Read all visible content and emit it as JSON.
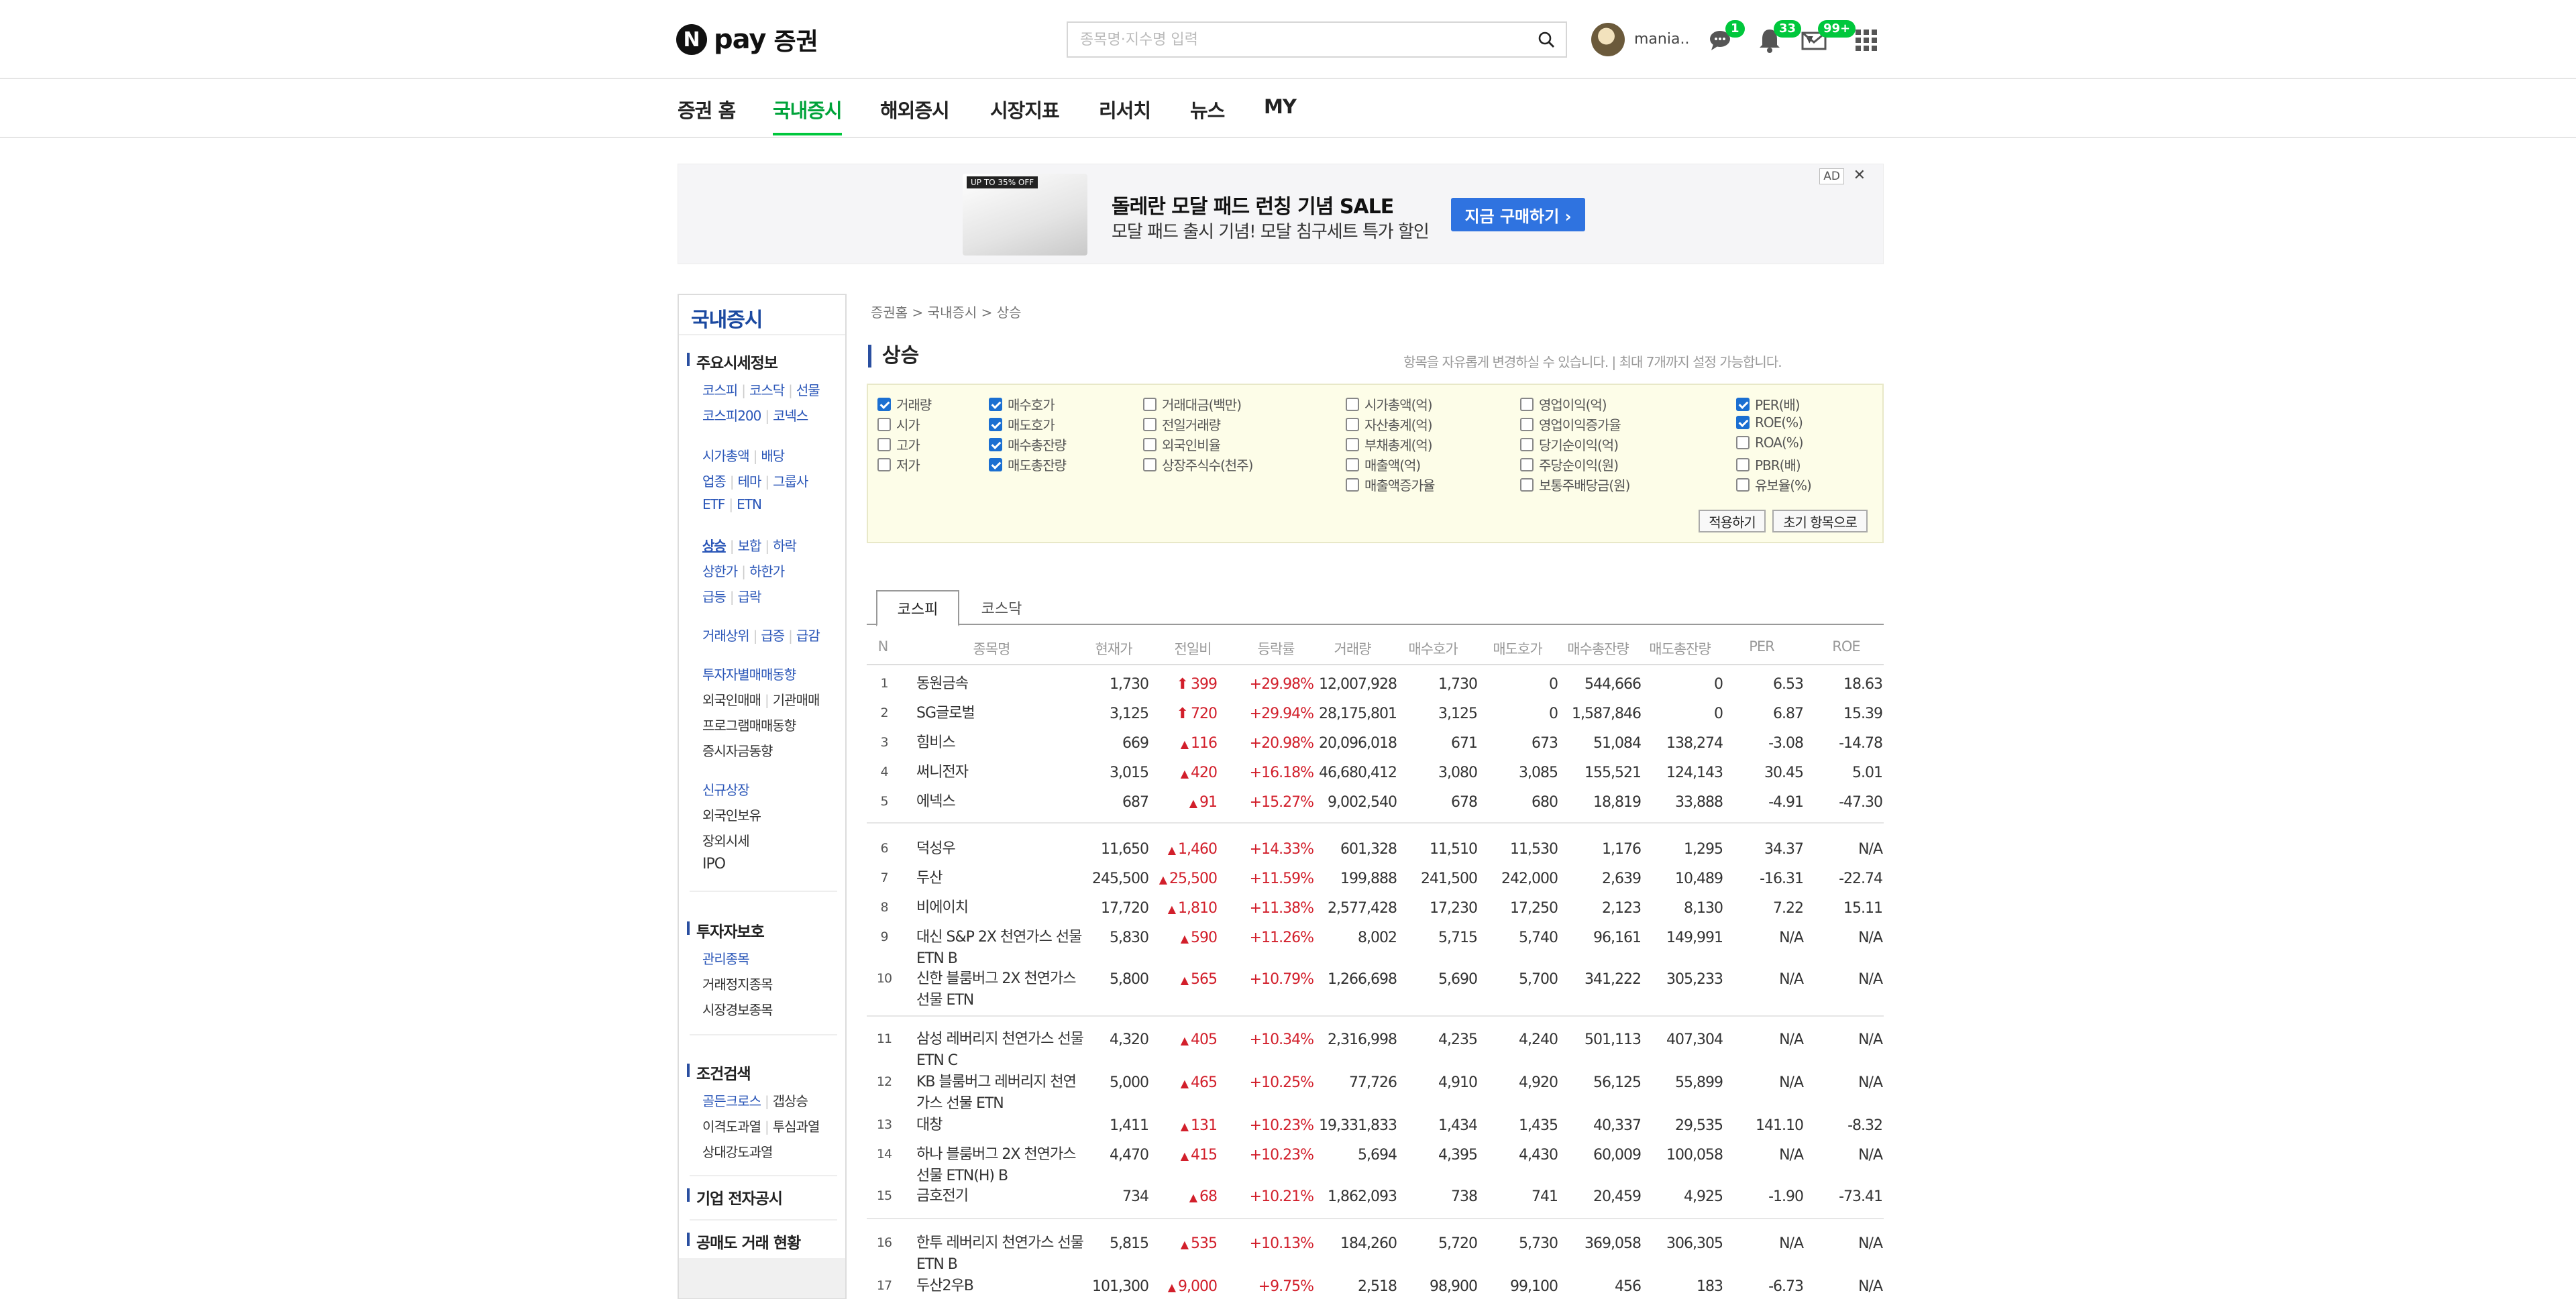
{
  "header": {
    "logo_n": "N",
    "logo_pay": "pay",
    "logo_service": "증권",
    "search_placeholder": "종목명·지수명 입력",
    "user_name": "mania..",
    "badges": {
      "talk": "1",
      "bell": "33",
      "mail": "99+"
    }
  },
  "nav": {
    "items": [
      {
        "label": "증권 홈",
        "active": false
      },
      {
        "label": "국내증시",
        "active": true
      },
      {
        "label": "해외증시",
        "active": false
      },
      {
        "label": "시장지표",
        "active": false
      },
      {
        "label": "리서치",
        "active": false
      },
      {
        "label": "뉴스",
        "active": false
      },
      {
        "label": "MY",
        "active": false
      }
    ]
  },
  "ad": {
    "image_tag": "UP TO 35% OFF",
    "title": "돌레란 모달 패드 런칭 기념 SALE",
    "subtitle": "모달 패드 출시 기념! 모달 침구세트 특가 할인",
    "button": "지금 구매하기 ›",
    "ad_label": "AD",
    "close": "✕"
  },
  "sidebar": {
    "title": "국내증시",
    "groups": [
      {
        "title": "주요시세정보"
      },
      {
        "title": "투자자보호"
      },
      {
        "title": "조건검색"
      },
      {
        "title": "기업 전자공시"
      },
      {
        "title": "공매도 거래 현황"
      }
    ],
    "links": {
      "kospi": "코스피",
      "kosdaq": "코스닥",
      "futures": "선물",
      "kospi200": "코스피200",
      "konex": "코넥스",
      "market_cap": "시가총액",
      "dividend": "배당",
      "sector": "업종",
      "theme": "테마",
      "group": "그룹사",
      "etf": "ETF",
      "etn": "ETN",
      "rise": "상승",
      "flat": "보합",
      "fall": "하락",
      "upper": "상한가",
      "lower": "하한가",
      "surge": "급등",
      "plunge": "급락",
      "volume_top": "거래상위",
      "vol_surge": "급증",
      "vol_drop": "급감",
      "investor": "투자자별매매동향",
      "foreign": "외국인매매",
      "institution": "기관매매",
      "program": "프로그램매매동향",
      "fund": "증시자금동향",
      "new_listing": "신규상장",
      "foreign_hold": "외국인보유",
      "otc": "장외시세",
      "ipo": "IPO",
      "managed": "관리종목",
      "halted": "거래정지종목",
      "warning": "시장경보종목",
      "golden": "골든크로스",
      "gap_up": "갭상승",
      "disparity": "이격도과열",
      "psych": "투심과열",
      "rsi": "상대강도과열"
    }
  },
  "content": {
    "breadcrumb": "증권홈 > 국내증시 > 상승",
    "title": "상승",
    "note": "항목을 자유롭게 변경하실 수 있습니다.  |  최대 7개까지 설정 가능합니다.",
    "options": [
      [
        {
          "label": "거래량",
          "on": true
        },
        {
          "label": "시가",
          "on": false
        },
        {
          "label": "고가",
          "on": false
        },
        {
          "label": "저가",
          "on": false
        }
      ],
      [
        {
          "label": "매수호가",
          "on": true
        },
        {
          "label": "매도호가",
          "on": true
        },
        {
          "label": "매수총잔량",
          "on": true
        },
        {
          "label": "매도총잔량",
          "on": true
        }
      ],
      [
        {
          "label": "거래대금(백만)",
          "on": false
        },
        {
          "label": "전일거래량",
          "on": false
        },
        {
          "label": "외국인비율",
          "on": false
        },
        {
          "label": "상장주식수(천주)",
          "on": false
        }
      ],
      [
        {
          "label": "시가총액(억)",
          "on": false
        },
        {
          "label": "자산총계(억)",
          "on": false
        },
        {
          "label": "부채총계(억)",
          "on": false
        },
        {
          "label": "매출액(억)",
          "on": false
        },
        {
          "label": "매출액증가율",
          "on": false
        }
      ],
      [
        {
          "label": "영업이익(억)",
          "on": false
        },
        {
          "label": "영업이익증가율",
          "on": false
        },
        {
          "label": "당기순이익(억)",
          "on": false
        },
        {
          "label": "주당순이익(원)",
          "on": false
        },
        {
          "label": "보통주배당금(원)",
          "on": false
        }
      ],
      [
        {
          "label": "PER(배)",
          "on": true
        },
        {
          "label": "ROE(%)",
          "on": true
        },
        {
          "label": "ROA(%)",
          "on": false
        },
        {
          "label": "PBR(배)",
          "on": false
        },
        {
          "label": "유보율(%)",
          "on": false
        }
      ]
    ],
    "apply": "적용하기",
    "reset": "초기 항목으로",
    "tabs": [
      "코스피",
      "코스닥"
    ],
    "columns": [
      "N",
      "종목명",
      "현재가",
      "전일비",
      "등락률",
      "거래량",
      "매수호가",
      "매도호가",
      "매수총잔량",
      "매도총잔량",
      "PER",
      "ROE"
    ],
    "rows": [
      {
        "n": "1",
        "name": "동원금속",
        "price": "1,730",
        "arrow": "⬆",
        "diff": "399",
        "rate": "+29.98%",
        "vol": "12,007,928",
        "bid": "1,730",
        "ask": "0",
        "bidq": "544,666",
        "askq": "0",
        "per": "6.53",
        "roe": "18.63"
      },
      {
        "n": "2",
        "name": "SG글로벌",
        "price": "3,125",
        "arrow": "⬆",
        "diff": "720",
        "rate": "+29.94%",
        "vol": "28,175,801",
        "bid": "3,125",
        "ask": "0",
        "bidq": "1,587,846",
        "askq": "0",
        "per": "6.87",
        "roe": "15.39"
      },
      {
        "n": "3",
        "name": "힘비스",
        "price": "669",
        "arrow": "▲",
        "diff": "116",
        "rate": "+20.98%",
        "vol": "20,096,018",
        "bid": "671",
        "ask": "673",
        "bidq": "51,084",
        "askq": "138,274",
        "per": "-3.08",
        "roe": "-14.78"
      },
      {
        "n": "4",
        "name": "써니전자",
        "price": "3,015",
        "arrow": "▲",
        "diff": "420",
        "rate": "+16.18%",
        "vol": "46,680,412",
        "bid": "3,080",
        "ask": "3,085",
        "bidq": "155,521",
        "askq": "124,143",
        "per": "30.45",
        "roe": "5.01"
      },
      {
        "n": "5",
        "name": "에넥스",
        "price": "687",
        "arrow": "▲",
        "diff": "91",
        "rate": "+15.27%",
        "vol": "9,002,540",
        "bid": "678",
        "ask": "680",
        "bidq": "18,819",
        "askq": "33,888",
        "per": "-4.91",
        "roe": "-47.30"
      },
      {
        "n": "6",
        "name": "덕성우",
        "price": "11,650",
        "arrow": "▲",
        "diff": "1,460",
        "rate": "+14.33%",
        "vol": "601,328",
        "bid": "11,510",
        "ask": "11,530",
        "bidq": "1,176",
        "askq": "1,295",
        "per": "34.37",
        "roe": "N/A"
      },
      {
        "n": "7",
        "name": "두산",
        "price": "245,500",
        "arrow": "▲",
        "diff": "25,500",
        "rate": "+11.59%",
        "vol": "199,888",
        "bid": "241,500",
        "ask": "242,000",
        "bidq": "2,639",
        "askq": "10,489",
        "per": "-16.31",
        "roe": "-22.74"
      },
      {
        "n": "8",
        "name": "비에이치",
        "price": "17,720",
        "arrow": "▲",
        "diff": "1,810",
        "rate": "+11.38%",
        "vol": "2,577,428",
        "bid": "17,230",
        "ask": "17,250",
        "bidq": "2,123",
        "askq": "8,130",
        "per": "7.22",
        "roe": "15.11"
      },
      {
        "n": "9",
        "name": "대신 S&P 2X 천연가스 선물 ETN B",
        "price": "5,830",
        "arrow": "▲",
        "diff": "590",
        "rate": "+11.26%",
        "vol": "8,002",
        "bid": "5,715",
        "ask": "5,740",
        "bidq": "96,161",
        "askq": "149,991",
        "per": "N/A",
        "roe": "N/A"
      },
      {
        "n": "10",
        "name": "신한 블룸버그 2X 천연가스 선물 ETN",
        "price": "5,800",
        "arrow": "▲",
        "diff": "565",
        "rate": "+10.79%",
        "vol": "1,266,698",
        "bid": "5,690",
        "ask": "5,700",
        "bidq": "341,222",
        "askq": "305,233",
        "per": "N/A",
        "roe": "N/A"
      },
      {
        "n": "11",
        "name": "삼성 레버리지 천연가스 선물 ETN C",
        "price": "4,320",
        "arrow": "▲",
        "diff": "405",
        "rate": "+10.34%",
        "vol": "2,316,998",
        "bid": "4,235",
        "ask": "4,240",
        "bidq": "501,113",
        "askq": "407,304",
        "per": "N/A",
        "roe": "N/A"
      },
      {
        "n": "12",
        "name": "KB 블룸버그 레버리지 천연가스 선물 ETN",
        "price": "5,000",
        "arrow": "▲",
        "diff": "465",
        "rate": "+10.25%",
        "vol": "77,726",
        "bid": "4,910",
        "ask": "4,920",
        "bidq": "56,125",
        "askq": "55,899",
        "per": "N/A",
        "roe": "N/A"
      },
      {
        "n": "13",
        "name": "대창",
        "price": "1,411",
        "arrow": "▲",
        "diff": "131",
        "rate": "+10.23%",
        "vol": "19,331,833",
        "bid": "1,434",
        "ask": "1,435",
        "bidq": "40,337",
        "askq": "29,535",
        "per": "141.10",
        "roe": "-8.32"
      },
      {
        "n": "14",
        "name": "하나 블룸버그 2X 천연가스 선물 ETN(H) B",
        "price": "4,470",
        "arrow": "▲",
        "diff": "415",
        "rate": "+10.23%",
        "vol": "5,694",
        "bid": "4,395",
        "ask": "4,430",
        "bidq": "60,009",
        "askq": "100,058",
        "per": "N/A",
        "roe": "N/A"
      },
      {
        "n": "15",
        "name": "금호전기",
        "price": "734",
        "arrow": "▲",
        "diff": "68",
        "rate": "+10.21%",
        "vol": "1,862,093",
        "bid": "738",
        "ask": "741",
        "bidq": "20,459",
        "askq": "4,925",
        "per": "-1.90",
        "roe": "-73.41"
      },
      {
        "n": "16",
        "name": "한투 레버리지 천연가스 선물 ETN B",
        "price": "5,815",
        "arrow": "▲",
        "diff": "535",
        "rate": "+10.13%",
        "vol": "184,260",
        "bid": "5,720",
        "ask": "5,730",
        "bidq": "369,058",
        "askq": "306,305",
        "per": "N/A",
        "roe": "N/A"
      },
      {
        "n": "17",
        "name": "두산2우B",
        "price": "101,300",
        "arrow": "▲",
        "diff": "9,000",
        "rate": "+9.75%",
        "vol": "2,518",
        "bid": "98,900",
        "ask": "99,100",
        "bidq": "456",
        "askq": "183",
        "per": "-6.73",
        "roe": "N/A"
      }
    ]
  }
}
